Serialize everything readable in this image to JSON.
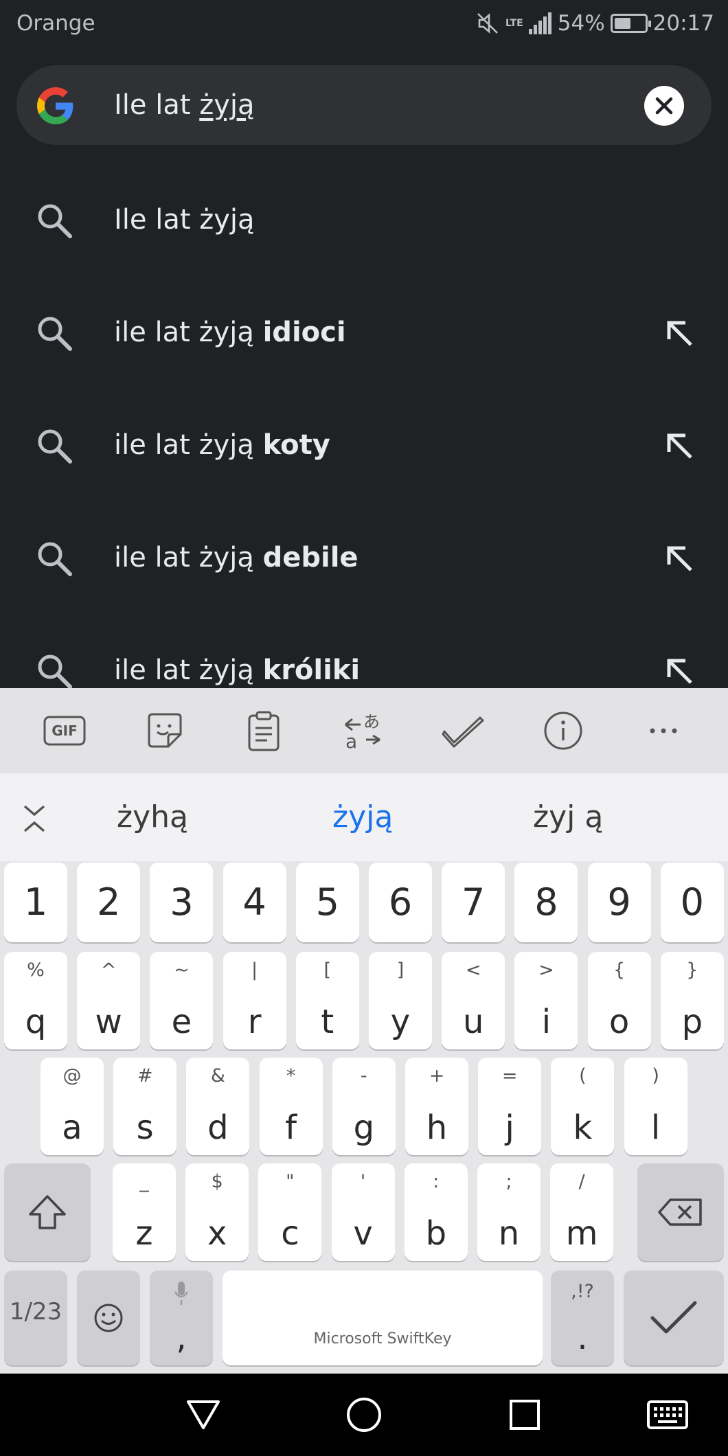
{
  "status_bar": {
    "carrier": "Orange",
    "network": "LTE",
    "battery": "54%",
    "battery_level": 0.54,
    "time": "20:17"
  },
  "search": {
    "query_prefix": "Ile lat ",
    "query_composing": "żyją"
  },
  "suggestions": [
    {
      "prefix": "Ile lat żyją",
      "bold": "",
      "has_arrow": false
    },
    {
      "prefix": "ile lat żyją ",
      "bold": "idioci",
      "has_arrow": true
    },
    {
      "prefix": "ile lat żyją ",
      "bold": "koty",
      "has_arrow": true
    },
    {
      "prefix": "ile lat żyją ",
      "bold": "debile",
      "has_arrow": true
    },
    {
      "prefix": "ile lat żyją ",
      "bold": "króliki",
      "has_arrow": true
    }
  ],
  "keyboard": {
    "toolbar": [
      "gif-button",
      "sticker-button",
      "clipboard-button",
      "translator-button",
      "tasks-button",
      "info-button",
      "more-button"
    ],
    "toolbar_gif_label": "GIF",
    "predictions": [
      "żyhą",
      "żyją",
      "żyj ą"
    ],
    "number_row": [
      "1",
      "2",
      "3",
      "4",
      "5",
      "6",
      "7",
      "8",
      "9",
      "0"
    ],
    "row1": [
      {
        "k": "q",
        "a": "%"
      },
      {
        "k": "w",
        "a": "^"
      },
      {
        "k": "e",
        "a": "~"
      },
      {
        "k": "r",
        "a": "|"
      },
      {
        "k": "t",
        "a": "["
      },
      {
        "k": "y",
        "a": "]"
      },
      {
        "k": "u",
        "a": "<"
      },
      {
        "k": "i",
        "a": ">"
      },
      {
        "k": "o",
        "a": "{"
      },
      {
        "k": "p",
        "a": "}"
      }
    ],
    "row2": [
      {
        "k": "a",
        "a": "@"
      },
      {
        "k": "s",
        "a": "#"
      },
      {
        "k": "d",
        "a": "&"
      },
      {
        "k": "f",
        "a": "*"
      },
      {
        "k": "g",
        "a": "-"
      },
      {
        "k": "h",
        "a": "+"
      },
      {
        "k": "j",
        "a": "="
      },
      {
        "k": "k",
        "a": "("
      },
      {
        "k": "l",
        "a": ")"
      }
    ],
    "row3": [
      {
        "k": "z",
        "a": "_"
      },
      {
        "k": "x",
        "a": "$"
      },
      {
        "k": "c",
        "a": "\""
      },
      {
        "k": "v",
        "a": "'"
      },
      {
        "k": "b",
        "a": ":"
      },
      {
        "k": "n",
        "a": ";"
      },
      {
        "k": "m",
        "a": "/"
      }
    ],
    "symbols_key": "1/23",
    "comma_key": ",",
    "period_key": ".",
    "period_alt": ",!?",
    "space_label": "Microsoft SwiftKey"
  }
}
